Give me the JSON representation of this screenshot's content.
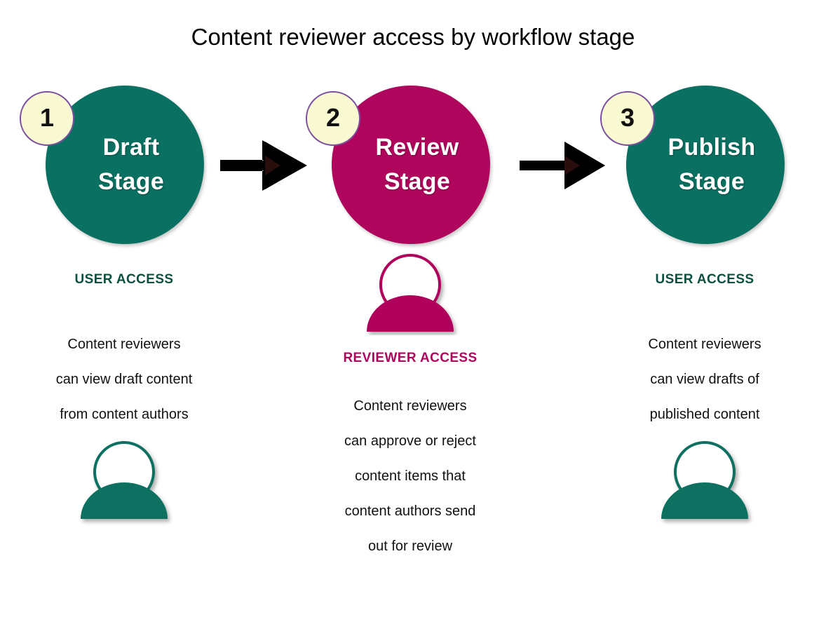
{
  "title": "Content reviewer access by workflow stage",
  "colors": {
    "teal": "#0a7061",
    "magenta": "#b0055c",
    "badge_fill": "#fafad2",
    "badge_border": "#7c4f9e",
    "heading_teal": "#0d5042",
    "arrow": "#000000",
    "background": "#ffffff",
    "stage_label": "#ffffff",
    "body_text": "#111111"
  },
  "stages": [
    {
      "number": "1",
      "name_line1": "Draft",
      "name_line2": "Stage",
      "accent": "teal",
      "access_heading": "USER ACCESS",
      "body_lines": [
        "Content reviewers",
        "can view draft content",
        "from content authors"
      ],
      "person_icon": "person-icon"
    },
    {
      "number": "2",
      "name_line1": "Review",
      "name_line2": "Stage",
      "accent": "magenta",
      "access_heading": "REVIEWER ACCESS",
      "body_lines": [
        "Content reviewers",
        "can approve or reject",
        "content items that",
        "content authors send",
        "out for review"
      ],
      "person_icon": "person-icon"
    },
    {
      "number": "3",
      "name_line1": "Publish",
      "name_line2": "Stage",
      "accent": "teal",
      "access_heading": "USER ACCESS",
      "body_lines": [
        "Content reviewers",
        "can view drafts of",
        "published content"
      ],
      "person_icon": "person-icon"
    }
  ],
  "arrows": [
    {
      "name": "arrow-draft-to-review",
      "from": "Draft Stage",
      "to": "Review Stage"
    },
    {
      "name": "arrow-review-to-publish",
      "from": "Review Stage",
      "to": "Publish Stage"
    }
  ]
}
